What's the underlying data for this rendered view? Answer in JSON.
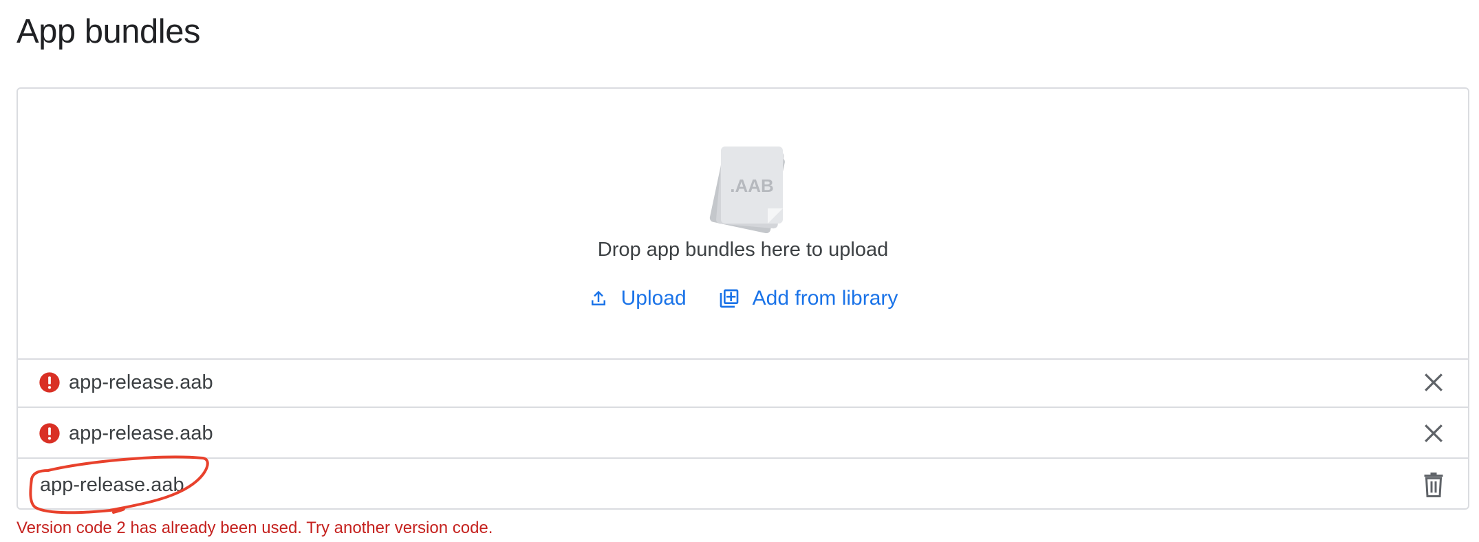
{
  "page": {
    "title": "App bundles"
  },
  "dropzone": {
    "illustration_label": ".AAB",
    "instruction": "Drop app bundles here to upload",
    "upload_label": "Upload",
    "library_label": "Add from library"
  },
  "files": [
    {
      "name": "app-release.aab",
      "status": "error",
      "action": "close-icon"
    },
    {
      "name": "app-release.aab",
      "status": "error",
      "action": "close-icon"
    },
    {
      "name": "app-release.aab",
      "status": "uploaded",
      "action": "trash-icon"
    }
  ],
  "error_message": "Version code 2 has already been used. Try another version code.",
  "colors": {
    "accent": "#1a73e8",
    "error": "#c5221f",
    "error_icon": "#d93025",
    "border": "#dadce0",
    "annotation": "#e8412c"
  }
}
